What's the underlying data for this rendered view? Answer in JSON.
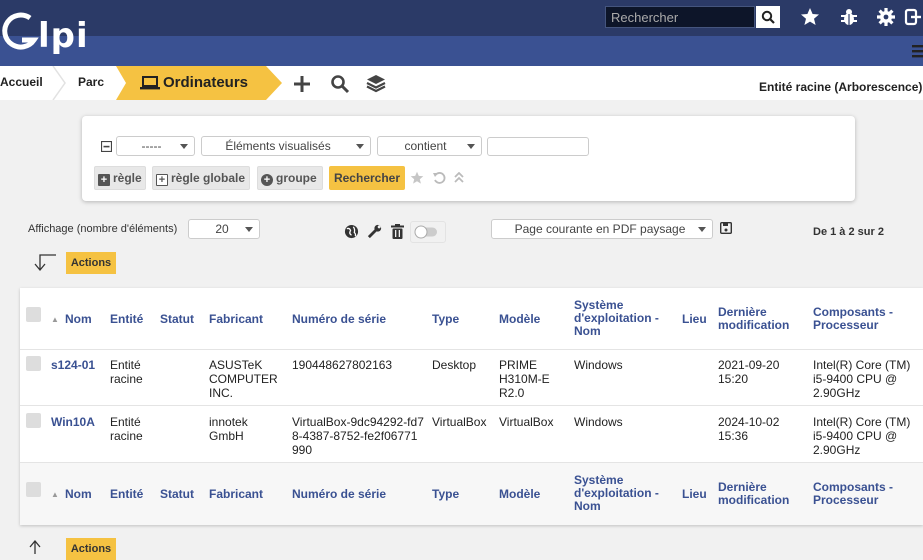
{
  "app": {
    "logo_text": "lpi",
    "search_placeholder": "Rechercher"
  },
  "breadcrumb": {
    "home": "Accueil",
    "parc": "Parc",
    "current": "Ordinateurs",
    "entity": "Entité racine (Arborescence)"
  },
  "search_panel": {
    "field_select": "-----",
    "display_select": "Éléments visualisés",
    "operator_select": "contient",
    "value_input": "",
    "btn_rule": "règle",
    "btn_global_rule": "règle globale",
    "btn_group": "groupe",
    "btn_search": "Rechercher"
  },
  "list_controls": {
    "display_label": "Affichage (nombre d'éléments)",
    "display_count": "20",
    "export_select": "Page courante en PDF paysage",
    "pagination": "De 1 à 2 sur 2",
    "actions_label": "Actions"
  },
  "table": {
    "headers": [
      "Nom",
      "Entité",
      "Statut",
      "Fabricant",
      "Numéro de série",
      "Type",
      "Modèle",
      "Système d'exploitation - Nom",
      "Lieu",
      "Dernière modification",
      "Composants - Processeur"
    ],
    "rows": [
      {
        "name": "s124-01",
        "entity": "Entité racine",
        "status": "",
        "manufacturer": "ASUSTeK COMPUTER INC.",
        "serial": "190448627802163",
        "type": "Desktop",
        "model": "PRIME H310M-E R2.0",
        "os": "Windows",
        "location": "",
        "modified": "2021-09-20 15:20",
        "processor": "Intel(R) Core (TM) i5-9400 CPU @ 2.90GHz"
      },
      {
        "name": "Win10A",
        "entity": "Entité racine",
        "status": "",
        "manufacturer": "innotek GmbH",
        "serial": "VirtualBox-9dc94292-fd78-4387-8752-fe2f06771990",
        "type": "VirtualBox",
        "model": "VirtualBox",
        "os": "Windows",
        "location": "",
        "modified": "2024-10-02 15:36",
        "processor": "Intel(R) Core (TM) i5-9400 CPU @ 2.90GHz"
      }
    ]
  }
}
